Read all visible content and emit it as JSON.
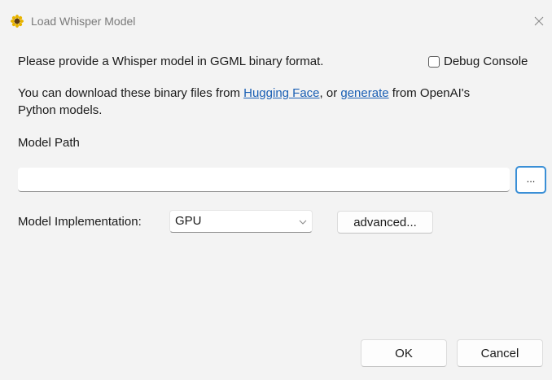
{
  "window": {
    "title": "Load Whisper Model",
    "app_icon": "sunflower-icon",
    "close_icon": "close-icon"
  },
  "intro": {
    "line1": "Please provide a Whisper model in GGML binary format.",
    "download_prefix": "You can download these binary files from ",
    "hugging_face_link": "Hugging Face",
    "download_middle": ", or ",
    "generate_link": "generate",
    "download_suffix": " from OpenAI's",
    "line3": "Python models."
  },
  "debug_console": {
    "label": "Debug Console",
    "checked": false
  },
  "model_path": {
    "label": "Model Path",
    "value": "",
    "browse_label": "..."
  },
  "model_implementation": {
    "label": "Model Implementation:",
    "selected": "GPU",
    "advanced_label": "advanced..."
  },
  "footer": {
    "ok_label": "OK",
    "cancel_label": "Cancel"
  },
  "colors": {
    "link": "#1a5fb4",
    "focus_border": "#3a8fd6",
    "background": "#f3f3f3"
  }
}
